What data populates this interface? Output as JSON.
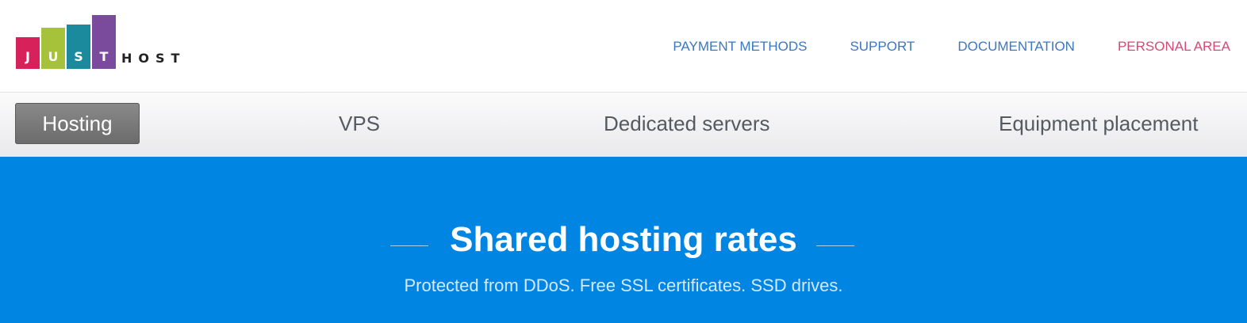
{
  "logo": {
    "letters": [
      "J",
      "U",
      "S",
      "T"
    ],
    "suffix": "HOST",
    "colors": [
      "#d6215a",
      "#a6c23a",
      "#1a8a9c",
      "#7a4a9c"
    ]
  },
  "top_nav": {
    "payment_methods": "PAYMENT METHODS",
    "support": "SUPPORT",
    "documentation": "DOCUMENTATION",
    "personal_area": "PERSONAL AREA"
  },
  "sub_nav": {
    "tabs": [
      "Hosting",
      "VPS",
      "Dedicated servers",
      "Equipment placement"
    ],
    "active": "Hosting"
  },
  "hero": {
    "title": "Shared hosting rates",
    "subtitle": "Protected from DDoS. Free SSL certificates. SSD drives."
  },
  "colors": {
    "hero_background": "#0085e3",
    "link_blue": "#3b77c2",
    "link_pink": "#d44a73",
    "active_tab": "#757575"
  }
}
